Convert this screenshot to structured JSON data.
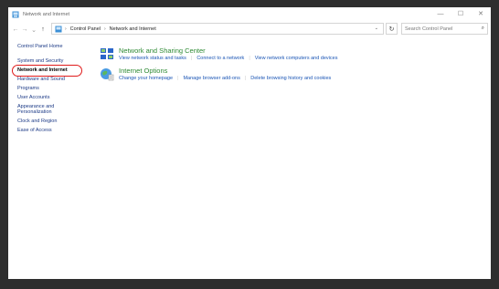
{
  "window": {
    "title": "Network and Internet",
    "controls": {
      "minimize": "—",
      "maximize": "☐",
      "close": "✕"
    }
  },
  "nav": {
    "back": "←",
    "forward": "→",
    "recent": "⌄",
    "up": "↑",
    "breadcrumb": [
      "Control Panel",
      "Network and Internet"
    ],
    "separator": "›",
    "dropdown": "⌄",
    "refresh": "↻",
    "search_placeholder": "Search Control Panel",
    "search_icon": "⌕"
  },
  "sidebar": {
    "home": "Control Panel Home",
    "items": [
      {
        "label": "System and Security"
      },
      {
        "label": "Network and Internet",
        "active": true
      },
      {
        "label": "Hardware and Sound"
      },
      {
        "label": "Programs"
      },
      {
        "label": "User Accounts"
      },
      {
        "label": "Appearance and Personalization"
      },
      {
        "label": "Clock and Region"
      },
      {
        "label": "Ease of Access"
      }
    ]
  },
  "sections": [
    {
      "title": "Network and Sharing Center",
      "icon": "network-sharing-icon",
      "links": [
        "View network status and tasks",
        "Connect to a network",
        "View network computers and devices"
      ]
    },
    {
      "title": "Internet Options",
      "icon": "internet-options-icon",
      "links": [
        "Change your homepage",
        "Manage browser add-ons",
        "Delete browsing history and cookies"
      ]
    }
  ],
  "colors": {
    "link": "#1a55b5",
    "section_title": "#2e8a34",
    "highlight": "#e01b1b",
    "sidebar_link": "#1c3a86"
  }
}
